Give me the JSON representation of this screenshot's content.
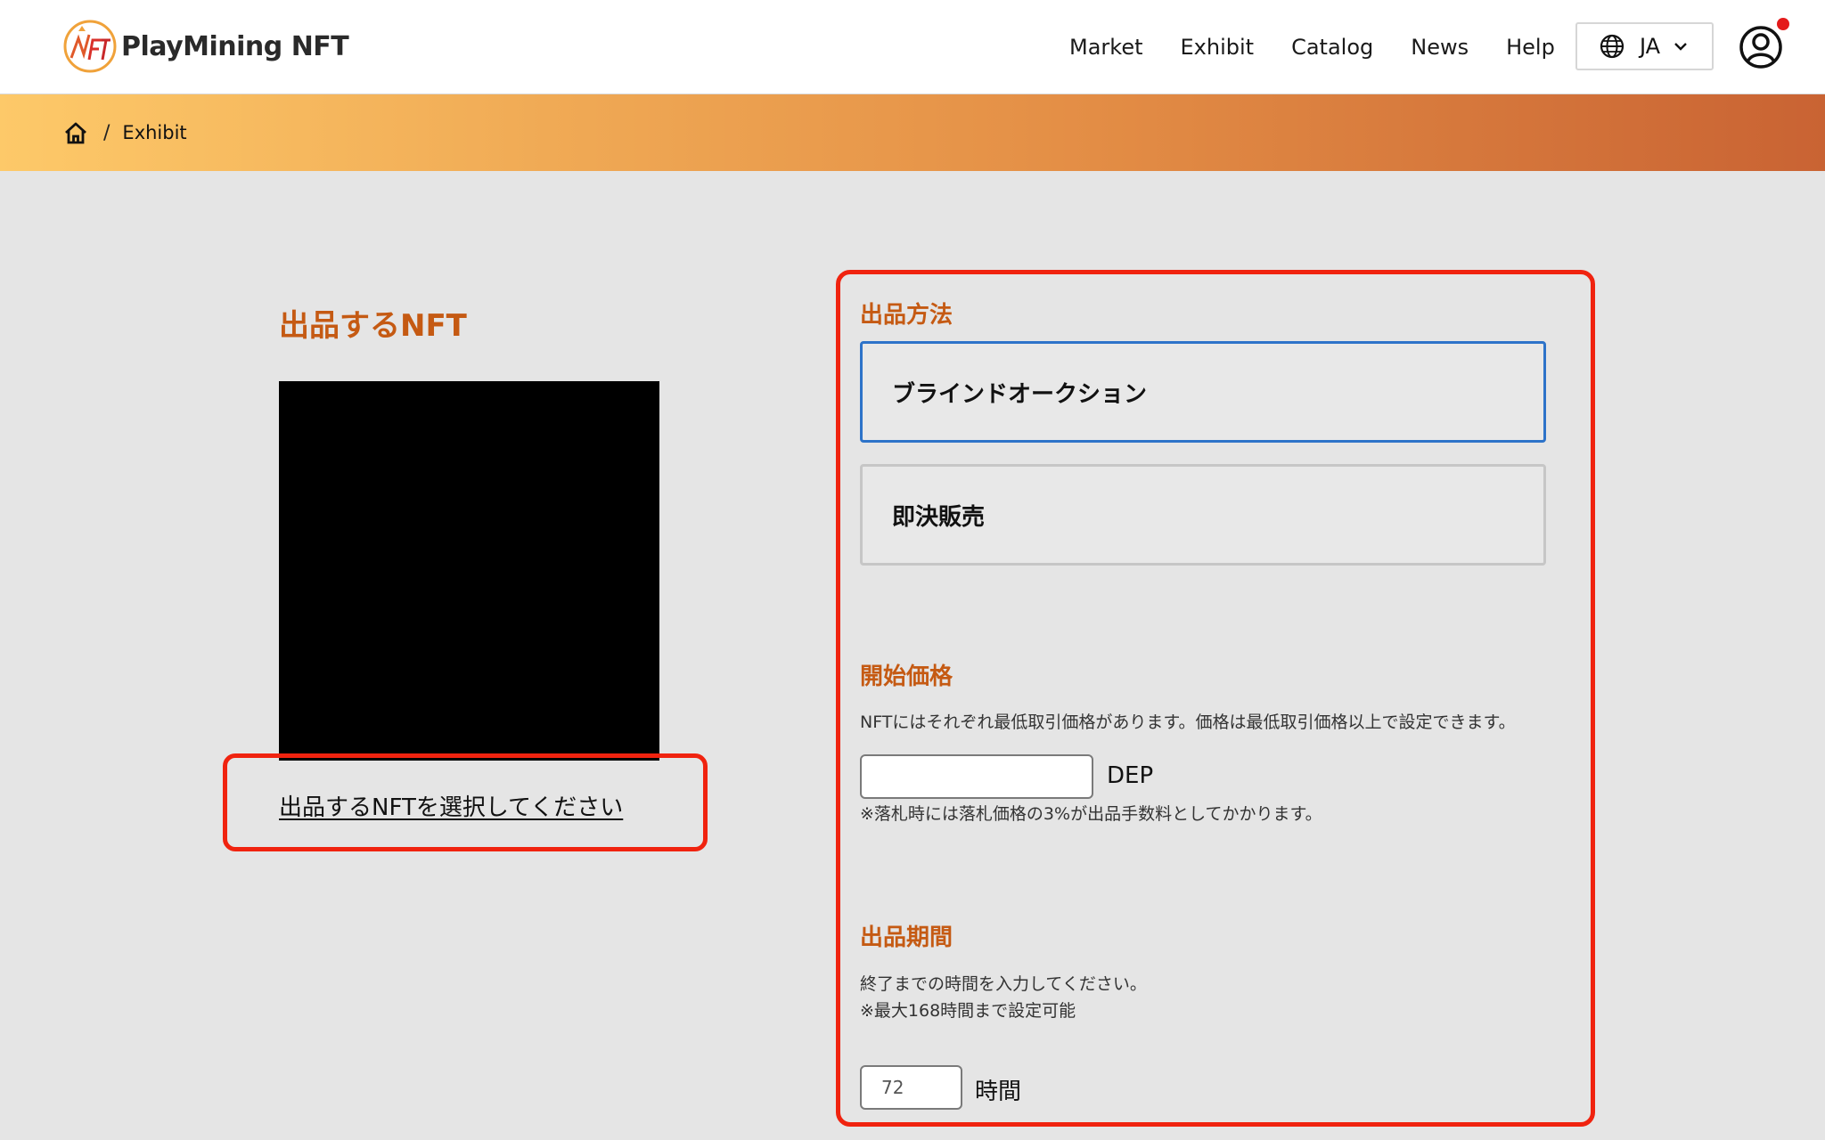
{
  "header": {
    "brand": "PlayMining NFT",
    "nav": [
      {
        "label": "Market"
      },
      {
        "label": "Exhibit"
      },
      {
        "label": "Catalog"
      },
      {
        "label": "News"
      },
      {
        "label": "Help"
      }
    ],
    "language": "JA",
    "icons": {
      "logo": "playmining-logo-icon",
      "language": "globe-icon",
      "dropdown": "chevron-down-icon",
      "account": "user-circle-icon"
    },
    "notification_color": "#e41b1b"
  },
  "breadcrumb": {
    "separator": "/",
    "current": "Exhibit"
  },
  "left": {
    "title": "出品するNFT",
    "select_link": "出品するNFTを選択してください"
  },
  "listing": {
    "method_title": "出品方法",
    "methods": [
      {
        "label": "ブラインドオークション",
        "selected": true
      },
      {
        "label": "即決販売",
        "selected": false
      }
    ],
    "price": {
      "title": "開始価格",
      "description": "NFTにはそれぞれ最低取引価格があります。価格は最低取引価格以上で設定できます。",
      "value": "",
      "unit": "DEP",
      "note": "※落札時には落札価格の3%が出品手数料としてかかります。"
    },
    "period": {
      "title": "出品期間",
      "description": "終了までの時間を入力してください。",
      "note": "※最大168時間まで設定可能",
      "value": "72",
      "unit": "時間"
    }
  },
  "colors": {
    "accent": "#c55a13",
    "highlight": "#f0230f",
    "selected_border": "#2d73c9"
  }
}
